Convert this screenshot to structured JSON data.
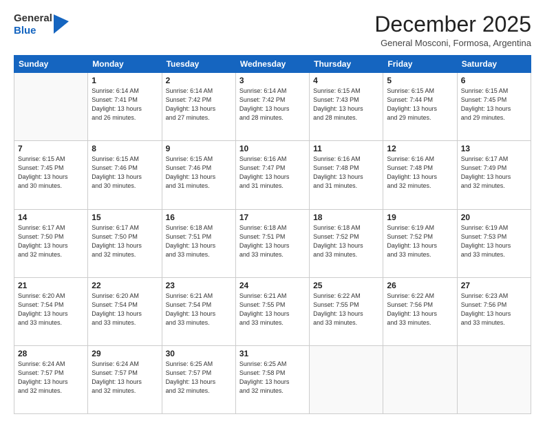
{
  "logo": {
    "line1": "General",
    "line2": "Blue"
  },
  "title": "December 2025",
  "subtitle": "General Mosconi, Formosa, Argentina",
  "days_of_week": [
    "Sunday",
    "Monday",
    "Tuesday",
    "Wednesday",
    "Thursday",
    "Friday",
    "Saturday"
  ],
  "weeks": [
    [
      {
        "day": "",
        "sunrise": "",
        "sunset": "",
        "daylight": ""
      },
      {
        "day": "1",
        "sunrise": "Sunrise: 6:14 AM",
        "sunset": "Sunset: 7:41 PM",
        "daylight": "Daylight: 13 hours and 26 minutes."
      },
      {
        "day": "2",
        "sunrise": "Sunrise: 6:14 AM",
        "sunset": "Sunset: 7:42 PM",
        "daylight": "Daylight: 13 hours and 27 minutes."
      },
      {
        "day": "3",
        "sunrise": "Sunrise: 6:14 AM",
        "sunset": "Sunset: 7:42 PM",
        "daylight": "Daylight: 13 hours and 28 minutes."
      },
      {
        "day": "4",
        "sunrise": "Sunrise: 6:15 AM",
        "sunset": "Sunset: 7:43 PM",
        "daylight": "Daylight: 13 hours and 28 minutes."
      },
      {
        "day": "5",
        "sunrise": "Sunrise: 6:15 AM",
        "sunset": "Sunset: 7:44 PM",
        "daylight": "Daylight: 13 hours and 29 minutes."
      },
      {
        "day": "6",
        "sunrise": "Sunrise: 6:15 AM",
        "sunset": "Sunset: 7:45 PM",
        "daylight": "Daylight: 13 hours and 29 minutes."
      }
    ],
    [
      {
        "day": "7",
        "sunrise": "Sunrise: 6:15 AM",
        "sunset": "Sunset: 7:45 PM",
        "daylight": "Daylight: 13 hours and 30 minutes."
      },
      {
        "day": "8",
        "sunrise": "Sunrise: 6:15 AM",
        "sunset": "Sunset: 7:46 PM",
        "daylight": "Daylight: 13 hours and 30 minutes."
      },
      {
        "day": "9",
        "sunrise": "Sunrise: 6:15 AM",
        "sunset": "Sunset: 7:46 PM",
        "daylight": "Daylight: 13 hours and 31 minutes."
      },
      {
        "day": "10",
        "sunrise": "Sunrise: 6:16 AM",
        "sunset": "Sunset: 7:47 PM",
        "daylight": "Daylight: 13 hours and 31 minutes."
      },
      {
        "day": "11",
        "sunrise": "Sunrise: 6:16 AM",
        "sunset": "Sunset: 7:48 PM",
        "daylight": "Daylight: 13 hours and 31 minutes."
      },
      {
        "day": "12",
        "sunrise": "Sunrise: 6:16 AM",
        "sunset": "Sunset: 7:48 PM",
        "daylight": "Daylight: 13 hours and 32 minutes."
      },
      {
        "day": "13",
        "sunrise": "Sunrise: 6:17 AM",
        "sunset": "Sunset: 7:49 PM",
        "daylight": "Daylight: 13 hours and 32 minutes."
      }
    ],
    [
      {
        "day": "14",
        "sunrise": "Sunrise: 6:17 AM",
        "sunset": "Sunset: 7:50 PM",
        "daylight": "Daylight: 13 hours and 32 minutes."
      },
      {
        "day": "15",
        "sunrise": "Sunrise: 6:17 AM",
        "sunset": "Sunset: 7:50 PM",
        "daylight": "Daylight: 13 hours and 32 minutes."
      },
      {
        "day": "16",
        "sunrise": "Sunrise: 6:18 AM",
        "sunset": "Sunset: 7:51 PM",
        "daylight": "Daylight: 13 hours and 33 minutes."
      },
      {
        "day": "17",
        "sunrise": "Sunrise: 6:18 AM",
        "sunset": "Sunset: 7:51 PM",
        "daylight": "Daylight: 13 hours and 33 minutes."
      },
      {
        "day": "18",
        "sunrise": "Sunrise: 6:18 AM",
        "sunset": "Sunset: 7:52 PM",
        "daylight": "Daylight: 13 hours and 33 minutes."
      },
      {
        "day": "19",
        "sunrise": "Sunrise: 6:19 AM",
        "sunset": "Sunset: 7:52 PM",
        "daylight": "Daylight: 13 hours and 33 minutes."
      },
      {
        "day": "20",
        "sunrise": "Sunrise: 6:19 AM",
        "sunset": "Sunset: 7:53 PM",
        "daylight": "Daylight: 13 hours and 33 minutes."
      }
    ],
    [
      {
        "day": "21",
        "sunrise": "Sunrise: 6:20 AM",
        "sunset": "Sunset: 7:54 PM",
        "daylight": "Daylight: 13 hours and 33 minutes."
      },
      {
        "day": "22",
        "sunrise": "Sunrise: 6:20 AM",
        "sunset": "Sunset: 7:54 PM",
        "daylight": "Daylight: 13 hours and 33 minutes."
      },
      {
        "day": "23",
        "sunrise": "Sunrise: 6:21 AM",
        "sunset": "Sunset: 7:54 PM",
        "daylight": "Daylight: 13 hours and 33 minutes."
      },
      {
        "day": "24",
        "sunrise": "Sunrise: 6:21 AM",
        "sunset": "Sunset: 7:55 PM",
        "daylight": "Daylight: 13 hours and 33 minutes."
      },
      {
        "day": "25",
        "sunrise": "Sunrise: 6:22 AM",
        "sunset": "Sunset: 7:55 PM",
        "daylight": "Daylight: 13 hours and 33 minutes."
      },
      {
        "day": "26",
        "sunrise": "Sunrise: 6:22 AM",
        "sunset": "Sunset: 7:56 PM",
        "daylight": "Daylight: 13 hours and 33 minutes."
      },
      {
        "day": "27",
        "sunrise": "Sunrise: 6:23 AM",
        "sunset": "Sunset: 7:56 PM",
        "daylight": "Daylight: 13 hours and 33 minutes."
      }
    ],
    [
      {
        "day": "28",
        "sunrise": "Sunrise: 6:24 AM",
        "sunset": "Sunset: 7:57 PM",
        "daylight": "Daylight: 13 hours and 32 minutes."
      },
      {
        "day": "29",
        "sunrise": "Sunrise: 6:24 AM",
        "sunset": "Sunset: 7:57 PM",
        "daylight": "Daylight: 13 hours and 32 minutes."
      },
      {
        "day": "30",
        "sunrise": "Sunrise: 6:25 AM",
        "sunset": "Sunset: 7:57 PM",
        "daylight": "Daylight: 13 hours and 32 minutes."
      },
      {
        "day": "31",
        "sunrise": "Sunrise: 6:25 AM",
        "sunset": "Sunset: 7:58 PM",
        "daylight": "Daylight: 13 hours and 32 minutes."
      },
      {
        "day": "",
        "sunrise": "",
        "sunset": "",
        "daylight": ""
      },
      {
        "day": "",
        "sunrise": "",
        "sunset": "",
        "daylight": ""
      },
      {
        "day": "",
        "sunrise": "",
        "sunset": "",
        "daylight": ""
      }
    ]
  ]
}
